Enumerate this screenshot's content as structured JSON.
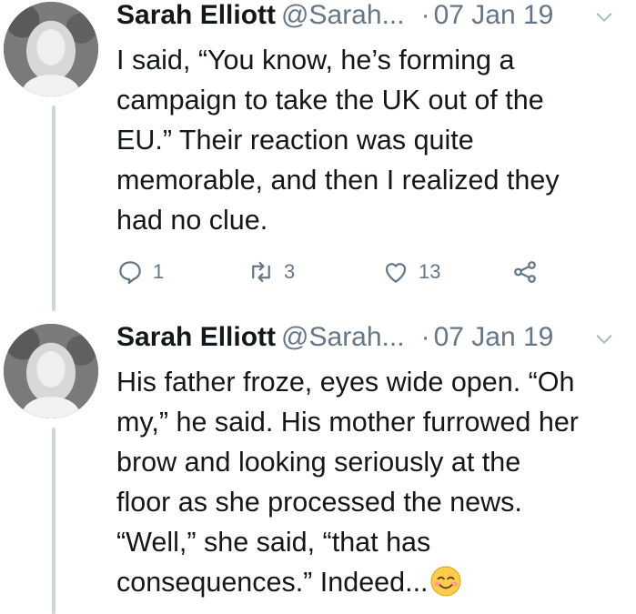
{
  "tweets": [
    {
      "author_name": "Sarah Elliott",
      "handle": "@Sarah...",
      "separator": "·",
      "date": "07 Jan 19",
      "lines": [
        "I said, “You know, he’s forming a",
        "campaign to take the UK out of the",
        "EU.” Their reaction was quite",
        "memorable, and then I realized they",
        "had no clue."
      ],
      "actions": {
        "replies": "1",
        "retweets": "3",
        "likes": "13"
      }
    },
    {
      "author_name": "Sarah Elliott",
      "handle": "@Sarah...",
      "separator": "·",
      "date": "07 Jan 19",
      "lines": [
        "His father froze, eyes wide open. “Oh",
        "my,” he said. His mother furrowed her",
        "brow and looking seriously at the",
        "floor as she processed the news.",
        "“Well,” she said, “that has",
        "consequences.” Indeed..."
      ],
      "trailing_emoji": "smiling-face-emoji"
    }
  ],
  "icons": {
    "reply": "reply-icon",
    "retweet": "retweet-icon",
    "like": "heart-icon",
    "share": "share-icon",
    "menu": "chevron-down-icon"
  },
  "colors": {
    "text": "#14171a",
    "secondary": "#657786",
    "thread_line": "#ccd6dd"
  }
}
